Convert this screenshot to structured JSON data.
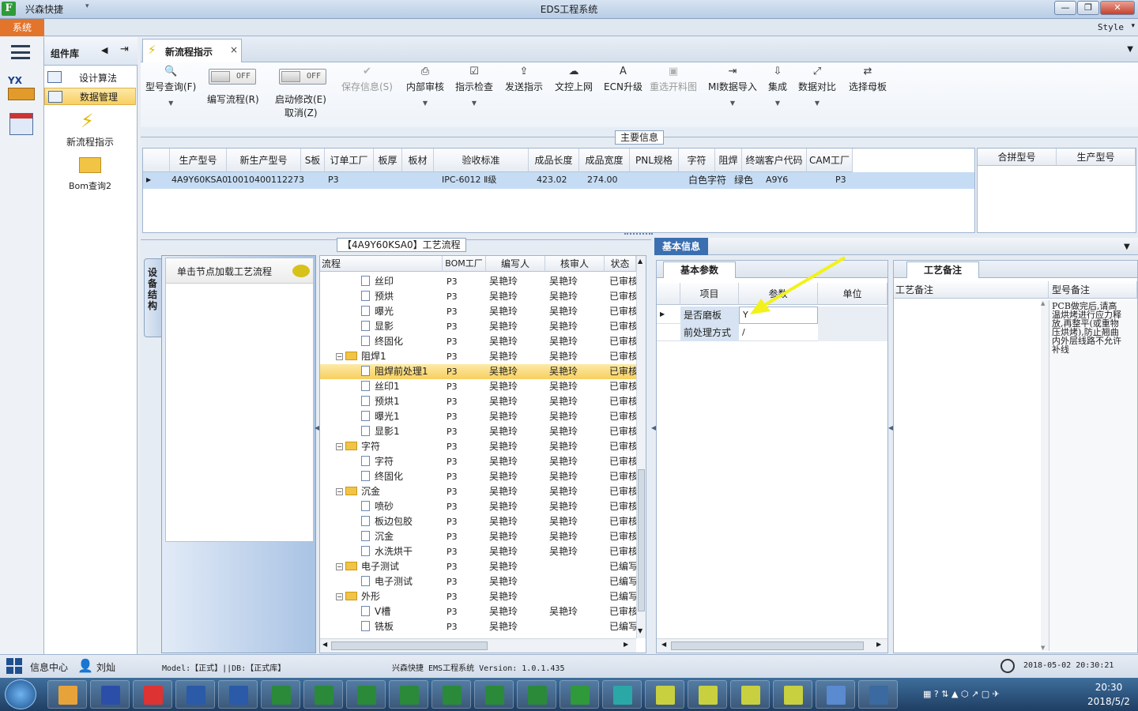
{
  "window": {
    "app_name": "兴森快捷",
    "title": "EDS工程系统",
    "style_label": "Style"
  },
  "ribbon": {
    "system_tab": "系统"
  },
  "components": {
    "title": "组件库",
    "items": [
      {
        "label": "设计算法"
      },
      {
        "label": "数据管理"
      }
    ],
    "big_items": [
      {
        "label": "新流程指示"
      },
      {
        "label": "Bom查询2"
      }
    ]
  },
  "doc_tab": {
    "label": "新流程指示",
    "close": "×"
  },
  "toolbar": {
    "model_query": "型号查询(F)",
    "toggle_off": "OFF",
    "edit_flow": "编写流程(R)",
    "start_modify": "启动修改(E)",
    "cancel": "取消(Z)",
    "save_info": "保存信息(S)",
    "internal_review": "内部审核",
    "instruction_check": "指示检查",
    "send_instruction": "发送指示",
    "doc_upload": "文控上网",
    "ecn_upgrade": "ECN升级",
    "reselect_material": "重选开料图",
    "mi_import": "MI数据导入",
    "integrate": "集成",
    "data_compare": "数据对比",
    "select_master": "选择母板"
  },
  "main_info": {
    "title": "主要信息",
    "columns": [
      "生产型号",
      "新生产型号",
      "S板",
      "订单工厂",
      "板厚",
      "板材",
      "验收标准",
      "成品长度",
      "成品宽度",
      "PNL规格",
      "字符",
      "阻焊",
      "终端客户代码",
      "CAM工厂"
    ],
    "row": {
      "prod_model": "4A9Y60KSA0",
      "new_model": "10010400112273",
      "s_board": "",
      "factory": "P3",
      "thickness": "",
      "material": "",
      "standard": "IPC-6012 Ⅱ级",
      "length": "423.02",
      "width": "274.00",
      "pnl": "",
      "char": "白色字符",
      "mask": "绿色",
      "customer": "A9Y6",
      "cam": "P3"
    },
    "side_columns": [
      "合拼型号",
      "生产型号"
    ]
  },
  "process": {
    "title": "【4A9Y60KSA0】工艺流程",
    "side_tab": "设备结构",
    "hint": "单击节点加载工艺流程",
    "columns": [
      "流程",
      "BOM工厂",
      "编写人",
      "核审人",
      "状态"
    ],
    "rows": [
      {
        "name": "丝印",
        "bom": "P3",
        "writer": "吴艳玲",
        "reviewer": "吴艳玲",
        "status": "已审核"
      },
      {
        "name": "预烘",
        "bom": "P3",
        "writer": "吴艳玲",
        "reviewer": "吴艳玲",
        "status": "已审核"
      },
      {
        "name": "曝光",
        "bom": "P3",
        "writer": "吴艳玲",
        "reviewer": "吴艳玲",
        "status": "已审核"
      },
      {
        "name": "显影",
        "bom": "P3",
        "writer": "吴艳玲",
        "reviewer": "吴艳玲",
        "status": "已审核"
      },
      {
        "name": "终固化",
        "bom": "P3",
        "writer": "吴艳玲",
        "reviewer": "吴艳玲",
        "status": "已审核"
      },
      {
        "name": "阻焊1",
        "bom": "P3",
        "writer": "吴艳玲",
        "reviewer": "吴艳玲",
        "status": "已审核"
      },
      {
        "name": "阻焊前处理1",
        "bom": "P3",
        "writer": "吴艳玲",
        "reviewer": "吴艳玲",
        "status": "已审核"
      },
      {
        "name": "丝印1",
        "bom": "P3",
        "writer": "吴艳玲",
        "reviewer": "吴艳玲",
        "status": "已审核"
      },
      {
        "name": "预烘1",
        "bom": "P3",
        "writer": "吴艳玲",
        "reviewer": "吴艳玲",
        "status": "已审核"
      },
      {
        "name": "曝光1",
        "bom": "P3",
        "writer": "吴艳玲",
        "reviewer": "吴艳玲",
        "status": "已审核"
      },
      {
        "name": "显影1",
        "bom": "P3",
        "writer": "吴艳玲",
        "reviewer": "吴艳玲",
        "status": "已审核"
      },
      {
        "name": "字符",
        "bom": "P3",
        "writer": "吴艳玲",
        "reviewer": "吴艳玲",
        "status": "已审核"
      },
      {
        "name": "字符",
        "bom": "P3",
        "writer": "吴艳玲",
        "reviewer": "吴艳玲",
        "status": "已审核"
      },
      {
        "name": "终固化",
        "bom": "P3",
        "writer": "吴艳玲",
        "reviewer": "吴艳玲",
        "status": "已审核"
      },
      {
        "name": "沉金",
        "bom": "P3",
        "writer": "吴艳玲",
        "reviewer": "吴艳玲",
        "status": "已审核"
      },
      {
        "name": "喷砂",
        "bom": "P3",
        "writer": "吴艳玲",
        "reviewer": "吴艳玲",
        "status": "已审核"
      },
      {
        "name": "板边包胶",
        "bom": "P3",
        "writer": "吴艳玲",
        "reviewer": "吴艳玲",
        "status": "已审核"
      },
      {
        "name": "沉金",
        "bom": "P3",
        "writer": "吴艳玲",
        "reviewer": "吴艳玲",
        "status": "已审核"
      },
      {
        "name": "水洗烘干",
        "bom": "P3",
        "writer": "吴艳玲",
        "reviewer": "吴艳玲",
        "status": "已审核"
      },
      {
        "name": "电子测试",
        "bom": "P3",
        "writer": "吴艳玲",
        "reviewer": "",
        "status": "已编写"
      },
      {
        "name": "电子测试",
        "bom": "P3",
        "writer": "吴艳玲",
        "reviewer": "",
        "status": "已编写"
      },
      {
        "name": "外形",
        "bom": "P3",
        "writer": "吴艳玲",
        "reviewer": "",
        "status": "已编写"
      },
      {
        "name": "V槽",
        "bom": "P3",
        "writer": "吴艳玲",
        "reviewer": "吴艳玲",
        "status": "已审核"
      },
      {
        "name": "铣板",
        "bom": "P3",
        "writer": "吴艳玲",
        "reviewer": "",
        "status": "已编写"
      }
    ]
  },
  "basic_info": {
    "title": "基本信息",
    "tab": "基本参数",
    "columns": [
      "项目",
      "参数",
      "单位"
    ],
    "rows": [
      {
        "item": "是否磨板",
        "param": "Y",
        "unit": ""
      },
      {
        "item": "前处理方式",
        "param": "/",
        "unit": ""
      }
    ]
  },
  "remark": {
    "tab": "工艺备注",
    "columns": [
      "工艺备注",
      "型号备注"
    ],
    "model_remark": "PCB做完后,请高温烘烤进行应力释放,再整平(或重物压烘烤),防止翘曲\n内外层线路不允许补线"
  },
  "status": {
    "info_center": "信息中心",
    "user": "刘灿",
    "model": "Model:【正式】||DB:【正式库】",
    "version": "兴森快捷 EMS工程系统 Version: 1.0.1.435",
    "datetime": "2018-05-02 20:30:21"
  },
  "taskbar": {
    "time": "20:30",
    "date": "2018/5/2"
  }
}
